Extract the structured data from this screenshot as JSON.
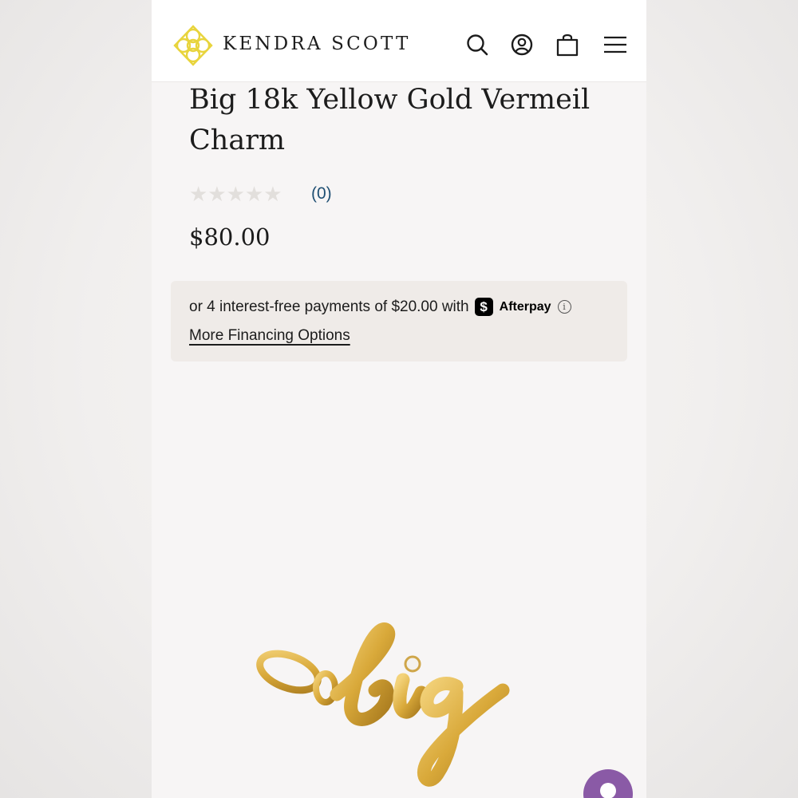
{
  "header": {
    "brand": "KENDRA SCOTT",
    "icons": [
      "logo-mark-icon",
      "search-icon",
      "account-icon",
      "bag-icon",
      "menu-icon"
    ],
    "brand_color": "#e8d43c"
  },
  "product": {
    "title": "Big 18k Yellow Gold Vermeil Charm",
    "rating_stars": "★★★★★",
    "rating_value": 0,
    "reviews": "(0)",
    "price": "$80.00"
  },
  "financing": {
    "afterpay_text": "or 4 interest-free payments of $20.00 with",
    "afterpay_badge": "$",
    "afterpay_name": "Afterpay",
    "info": "i",
    "more_options": "More Financing Options"
  },
  "colors": {
    "review_link": "#1f4f73",
    "chat_button": "#8a5aa6",
    "gold": "#d9a93a"
  }
}
